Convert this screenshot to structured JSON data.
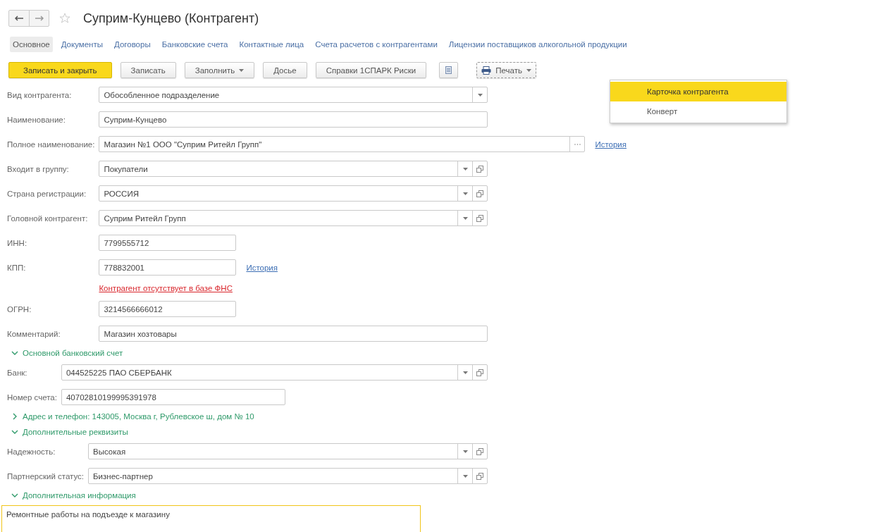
{
  "title": "Суприм-Кунцево (Контрагент)",
  "tabs": [
    {
      "label": "Основное",
      "selected": true
    },
    {
      "label": "Документы",
      "selected": false
    },
    {
      "label": "Договоры",
      "selected": false
    },
    {
      "label": "Банковские счета",
      "selected": false
    },
    {
      "label": "Контактные лица",
      "selected": false
    },
    {
      "label": "Счета расчетов с контрагентами",
      "selected": false
    },
    {
      "label": "Лицензии поставщиков алкогольной продукции",
      "selected": false
    }
  ],
  "toolbar": [
    {
      "kind": "primary",
      "label": "Записать и закрыть"
    },
    {
      "kind": "button",
      "label": "Записать"
    },
    {
      "kind": "menu",
      "label": "Заполнить"
    },
    {
      "kind": "button",
      "label": "Досье"
    },
    {
      "kind": "button",
      "label": "Справки 1СПАРК Риски"
    },
    {
      "kind": "icon"
    },
    {
      "kind": "print",
      "label": "Печать"
    }
  ],
  "print_menu": {
    "open": true,
    "items": [
      {
        "label": "Карточка контрагента",
        "selected": true
      },
      {
        "label": "Конверт",
        "selected": false
      }
    ]
  },
  "groups": [
    {
      "fields": [
        {
          "kind": "select",
          "label": "Вид контрагента:",
          "value": "Обособленное подразделение"
        },
        {
          "kind": "long",
          "label": "Наименование:",
          "value": "Суприм-Кунцево"
        },
        {
          "kind": "pick",
          "label": "Полное наименование:",
          "value": "Магазин №1 ООО \"Суприм Ритейл Групп\"",
          "link": "История"
        },
        {
          "kind": "choice",
          "label": "Входит в группу:",
          "value": "Покупатели"
        },
        {
          "kind": "choice",
          "label": "Страна регистрации:",
          "value": "РОССИЯ"
        },
        {
          "kind": "choice",
          "label": "Головной контрагент:",
          "value": "Суприм Ритейл Групп"
        },
        {
          "kind": "short",
          "label": "ИНН:",
          "value": "7799555712"
        },
        {
          "kind": "short",
          "label": "КПП:",
          "value": "778832001",
          "link": "История"
        },
        {
          "kind": "error",
          "value": "Контрагент отсутствует в базе ФНС"
        },
        {
          "kind": "short",
          "label": "ОГРН:",
          "value": "3214566666012"
        },
        {
          "kind": "long",
          "label": "Комментарий:",
          "value": "Магазин хозтовары"
        }
      ]
    },
    {
      "header": {
        "label": "Основной банковский счет",
        "expanded": true
      },
      "fields": [
        {
          "kind": "choice",
          "label": "Банк:",
          "value": "044525225 ПАО СБЕРБАНК"
        },
        {
          "kind": "account",
          "label": "Номер счета:",
          "value": "40702810199995391978"
        }
      ]
    },
    {
      "header": {
        "label": "Адрес и телефон: 143005, Москва г, Рублевское ш, дом № 10",
        "expanded": false
      }
    },
    {
      "header": {
        "label": "Дополнительные реквизиты",
        "expanded": true
      },
      "fields": [
        {
          "kind": "choice",
          "label": "Надежность:",
          "value": "Высокая"
        },
        {
          "kind": "choice",
          "label": "Партнерский статус:",
          "value": "Бизнес-партнер"
        }
      ]
    },
    {
      "header": {
        "label": "Дополнительная информация",
        "expanded": true
      },
      "fields": [
        {
          "kind": "note",
          "value": "Ремонтные работы на подъезде к магазину"
        }
      ]
    }
  ]
}
